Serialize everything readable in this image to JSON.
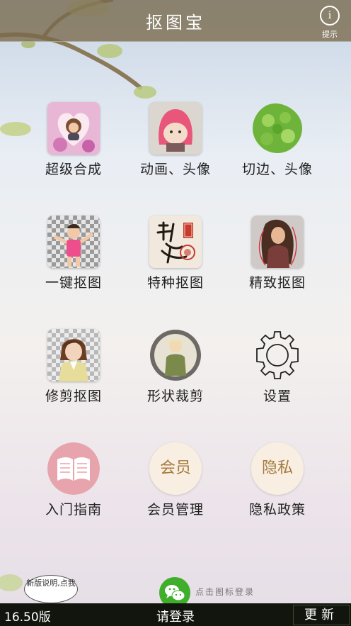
{
  "header": {
    "title": "抠图宝",
    "hint_icon": "i",
    "hint_label": "提示"
  },
  "grid": {
    "row1": [
      "超级合成",
      "动画、头像",
      "切边、头像"
    ],
    "row2": [
      "一键抠图",
      "特种抠图",
      "精致抠图"
    ],
    "row3": [
      "修剪抠图",
      "形状裁剪",
      "设置"
    ],
    "row4": [
      "入门指南",
      "会员管理",
      "隐私政策"
    ],
    "member_icon_text": "会员",
    "privacy_icon_text": "隐私"
  },
  "footer": {
    "bubble_text": "新版说明,点我",
    "wechat_text": "点击图标登录",
    "version": "16.50版",
    "login": "请登录",
    "update": "更新"
  },
  "colors": {
    "titlebar": "#78694b",
    "bottombar": "#12150e",
    "wechat": "#3fae2a",
    "guide": "#e8a4ac"
  }
}
